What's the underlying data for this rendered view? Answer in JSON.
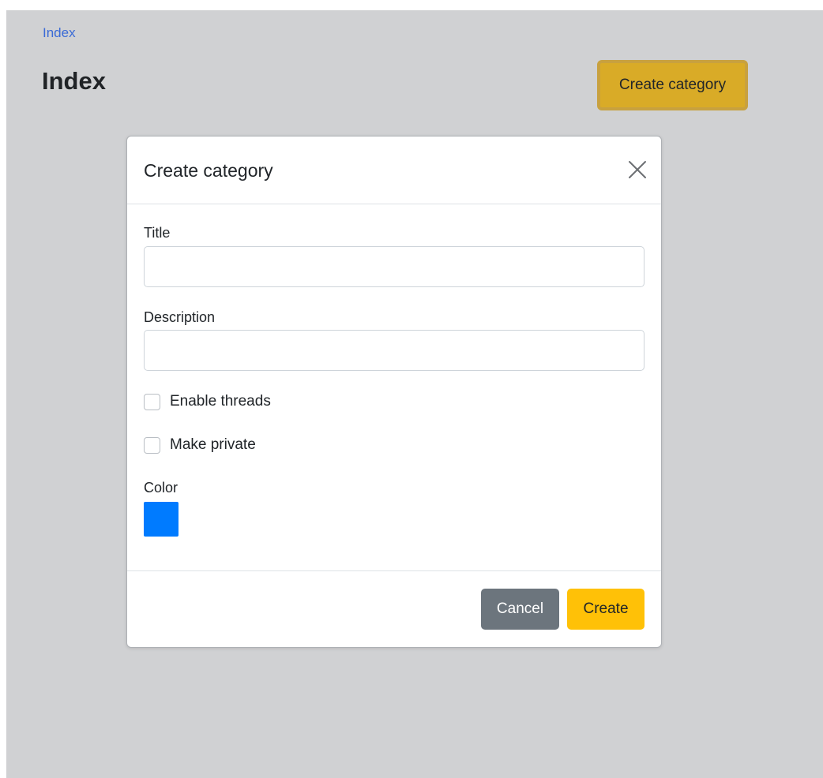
{
  "page": {
    "breadcrumb": "Index",
    "title": "Index",
    "create_button_label": "Create category"
  },
  "modal": {
    "title": "Create category",
    "close_icon": "close-icon",
    "fields": {
      "title_label": "Title",
      "title_value": "",
      "description_label": "Description",
      "description_value": "",
      "enable_threads_label": "Enable threads",
      "enable_threads_checked": false,
      "make_private_label": "Make private",
      "make_private_checked": false,
      "color_label": "Color",
      "color_value": "#007bff"
    },
    "footer": {
      "cancel_label": "Cancel",
      "create_label": "Create"
    }
  },
  "colors": {
    "backdrop": "#d0d1d3",
    "link": "#3b6bd6",
    "accent_button": "#d9ab27",
    "cancel_button": "#6c757d",
    "create_button": "#ffc107"
  }
}
